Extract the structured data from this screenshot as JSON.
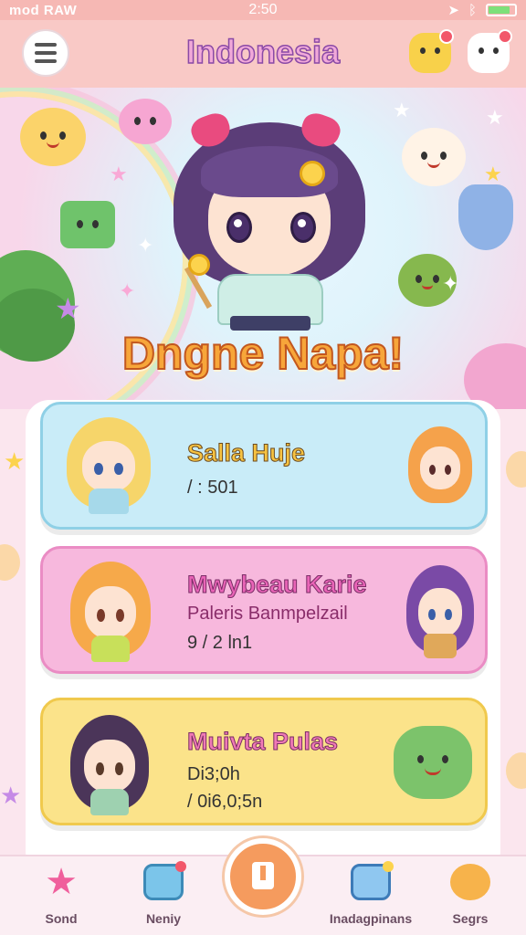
{
  "status_bar": {
    "carrier": "mod RAW",
    "time": "2:50"
  },
  "app_bar": {
    "title": "Indonesia"
  },
  "hero": {
    "title": "Dngne Napa!"
  },
  "cards": [
    {
      "title": "Salla Huje",
      "meta": "/ : 501"
    },
    {
      "title": "Mwybeau Karie",
      "subtitle": "Paleris Banmpelzail",
      "meta": "9 / 2 ln1"
    },
    {
      "title": "Muivta Pulas",
      "subtitle": "Di3;0h",
      "meta": "/ 0i6,0;5n"
    }
  ],
  "bottom_nav": {
    "items": [
      {
        "label": "Sond",
        "icon": "star-icon"
      },
      {
        "label": "Neniy",
        "icon": "card-icon"
      },
      {
        "label": "Inadagpinans",
        "icon": "chat-icon"
      },
      {
        "label": "Segrs",
        "icon": "mascot-icon"
      }
    ],
    "center_icon": "center-action-icon"
  },
  "colors": {
    "status": "#f6b8b4",
    "appbar": "#f9c9c6",
    "card_blue": "#c9ecf8",
    "card_pink": "#f7b8dd",
    "card_yellow": "#fbe38a",
    "accent": "#f59b5e"
  }
}
